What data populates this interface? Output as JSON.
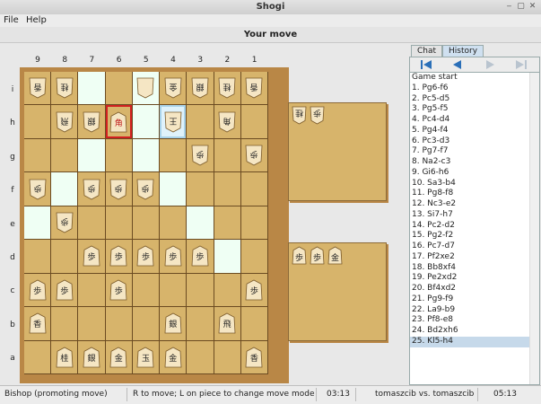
{
  "window": {
    "title": "Shogi"
  },
  "menu": {
    "file": "File",
    "help": "Help"
  },
  "status_top": "Your move",
  "board": {
    "files": [
      "9",
      "8",
      "7",
      "6",
      "5",
      "4",
      "3",
      "2",
      "1"
    ],
    "ranks": [
      "i",
      "h",
      "g",
      "f",
      "e",
      "d",
      "c",
      "b",
      "a"
    ]
  },
  "pieces": [
    {
      "r": 0,
      "c": 0,
      "label": "香",
      "side": "gote"
    },
    {
      "r": 0,
      "c": 1,
      "label": "桂",
      "side": "gote"
    },
    {
      "r": 0,
      "c": 4,
      "label": "",
      "side": "gote"
    },
    {
      "r": 0,
      "c": 5,
      "label": "金",
      "side": "gote"
    },
    {
      "r": 0,
      "c": 6,
      "label": "銀",
      "side": "gote"
    },
    {
      "r": 0,
      "c": 7,
      "label": "桂",
      "side": "gote"
    },
    {
      "r": 0,
      "c": 8,
      "label": "香",
      "side": "gote"
    },
    {
      "r": 1,
      "c": 1,
      "label": "飛",
      "side": "gote"
    },
    {
      "r": 1,
      "c": 2,
      "label": "銀",
      "side": "gote"
    },
    {
      "r": 1,
      "c": 3,
      "label": "角",
      "side": "sente",
      "promoted": true
    },
    {
      "r": 1,
      "c": 5,
      "label": "王",
      "side": "gote"
    },
    {
      "r": 1,
      "c": 7,
      "label": "角",
      "side": "gote"
    },
    {
      "r": 2,
      "c": 6,
      "label": "歩",
      "side": "gote"
    },
    {
      "r": 2,
      "c": 8,
      "label": "歩",
      "side": "gote"
    },
    {
      "r": 3,
      "c": 0,
      "label": "歩",
      "side": "gote"
    },
    {
      "r": 3,
      "c": 2,
      "label": "歩",
      "side": "gote"
    },
    {
      "r": 3,
      "c": 3,
      "label": "歩",
      "side": "gote"
    },
    {
      "r": 3,
      "c": 4,
      "label": "歩",
      "side": "gote"
    },
    {
      "r": 4,
      "c": 1,
      "label": "歩",
      "side": "gote"
    },
    {
      "r": 5,
      "c": 2,
      "label": "歩",
      "side": "sente"
    },
    {
      "r": 5,
      "c": 3,
      "label": "歩",
      "side": "sente"
    },
    {
      "r": 5,
      "c": 4,
      "label": "歩",
      "side": "sente"
    },
    {
      "r": 5,
      "c": 5,
      "label": "歩",
      "side": "sente"
    },
    {
      "r": 5,
      "c": 6,
      "label": "歩",
      "side": "sente"
    },
    {
      "r": 6,
      "c": 0,
      "label": "歩",
      "side": "sente"
    },
    {
      "r": 6,
      "c": 1,
      "label": "歩",
      "side": "sente"
    },
    {
      "r": 6,
      "c": 3,
      "label": "歩",
      "side": "sente"
    },
    {
      "r": 6,
      "c": 8,
      "label": "歩",
      "side": "sente"
    },
    {
      "r": 7,
      "c": 0,
      "label": "香",
      "side": "sente"
    },
    {
      "r": 7,
      "c": 5,
      "label": "銀",
      "side": "sente"
    },
    {
      "r": 7,
      "c": 7,
      "label": "飛",
      "side": "sente"
    },
    {
      "r": 8,
      "c": 1,
      "label": "桂",
      "side": "sente"
    },
    {
      "r": 8,
      "c": 2,
      "label": "銀",
      "side": "sente"
    },
    {
      "r": 8,
      "c": 3,
      "label": "金",
      "side": "sente"
    },
    {
      "r": 8,
      "c": 4,
      "label": "玉",
      "side": "sente"
    },
    {
      "r": 8,
      "c": 5,
      "label": "金",
      "side": "sente"
    },
    {
      "r": 8,
      "c": 8,
      "label": "香",
      "side": "sente"
    }
  ],
  "highlights": [
    [
      0,
      2
    ],
    [
      0,
      4
    ],
    [
      1,
      4
    ],
    [
      2,
      2
    ],
    [
      2,
      4
    ],
    [
      3,
      1
    ],
    [
      3,
      5
    ],
    [
      4,
      0
    ],
    [
      4,
      6
    ],
    [
      5,
      7
    ]
  ],
  "selected_red": [
    1,
    3
  ],
  "selected_blue": [
    1,
    5
  ],
  "hand_top": [
    {
      "label": "桂",
      "side": "gote"
    },
    {
      "label": "歩",
      "side": "gote"
    }
  ],
  "hand_bottom": [
    {
      "label": "歩",
      "side": "sente"
    },
    {
      "label": "歩",
      "side": "sente"
    },
    {
      "label": "金",
      "side": "sente"
    }
  ],
  "tabs": [
    "Chat",
    "History"
  ],
  "history": [
    "Game start",
    "1.  Pg6-f6",
    "2.  Pc5-d5",
    "3.  Pg5-f5",
    "4.  Pc4-d4",
    "5.  Pg4-f4",
    "6.  Pc3-d3",
    "7.  Pg7-f7",
    "8.  Na2-c3",
    "9.  Gi6-h6",
    "10.  Sa3-b4",
    "11.  Pg8-f8",
    "12.  Nc3-e2",
    "13.  Si7-h7",
    "14.  Pc2-d2",
    "15.  Pg2-f2",
    "16.  Pc7-d7",
    "17.  Pf2xe2",
    "18.  Bb8xf4",
    "19.  Pe2xd2",
    "20.  Bf4xd2",
    "21.  Pg9-f9",
    "22.  La9-b9",
    "23.  Pf8-e8",
    "24.  Bd2xh6",
    "25.  Kl5-h4"
  ],
  "history_selected": 25,
  "statusbar": {
    "piece": "Bishop (promoting move)",
    "hint": "R to move; L on piece to change move mode",
    "time1": "03:13",
    "players": "tomaszcib vs. tomaszcib",
    "time2": "05:13"
  }
}
